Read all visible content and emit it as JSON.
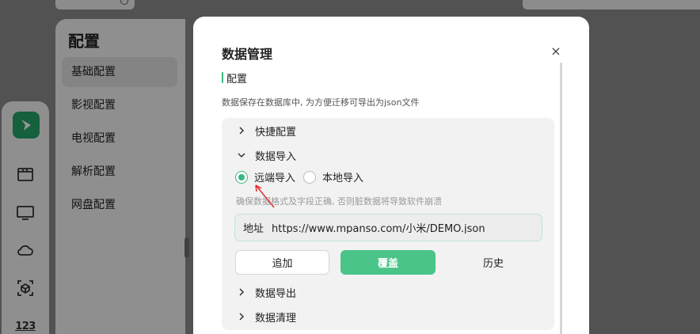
{
  "background": {
    "settings": {
      "title": "配置",
      "items": [
        {
          "label": "基础配置",
          "active": true
        },
        {
          "label": "影视配置",
          "active": false
        },
        {
          "label": "电视配置",
          "active": false
        },
        {
          "label": "解析配置",
          "active": false
        },
        {
          "label": "网盘配置",
          "active": false
        }
      ]
    },
    "rail": {
      "icons": [
        "app-logo-icon",
        "film-icon",
        "tv-icon",
        "cloud-icon",
        "cube-icon"
      ],
      "numeric_label": "123"
    }
  },
  "modal": {
    "title": "数据管理",
    "close_glyph": "×",
    "section_label": "配置",
    "section_desc": "数据保存在数据库中, 为方便迁移可导出为json文件",
    "panels": {
      "quick": "快捷配置",
      "import": "数据导入",
      "export": "数据导出",
      "clear": "数据清理"
    },
    "import": {
      "remote_label": "远端导入",
      "local_label": "本地导入",
      "selected": "remote",
      "hint": "确保数据格式及字段正确, 否则脏数据将导致软件崩溃",
      "url_prefix": "地址",
      "url_value": "https://www.mpanso.com/小米/DEMO.json",
      "buttons": {
        "append": "追加",
        "override": "覆盖",
        "history": "历史"
      }
    }
  },
  "colors": {
    "accent": "#3bb77e",
    "primary_button": "#4ac489",
    "annotation_arrow": "#e03030"
  }
}
